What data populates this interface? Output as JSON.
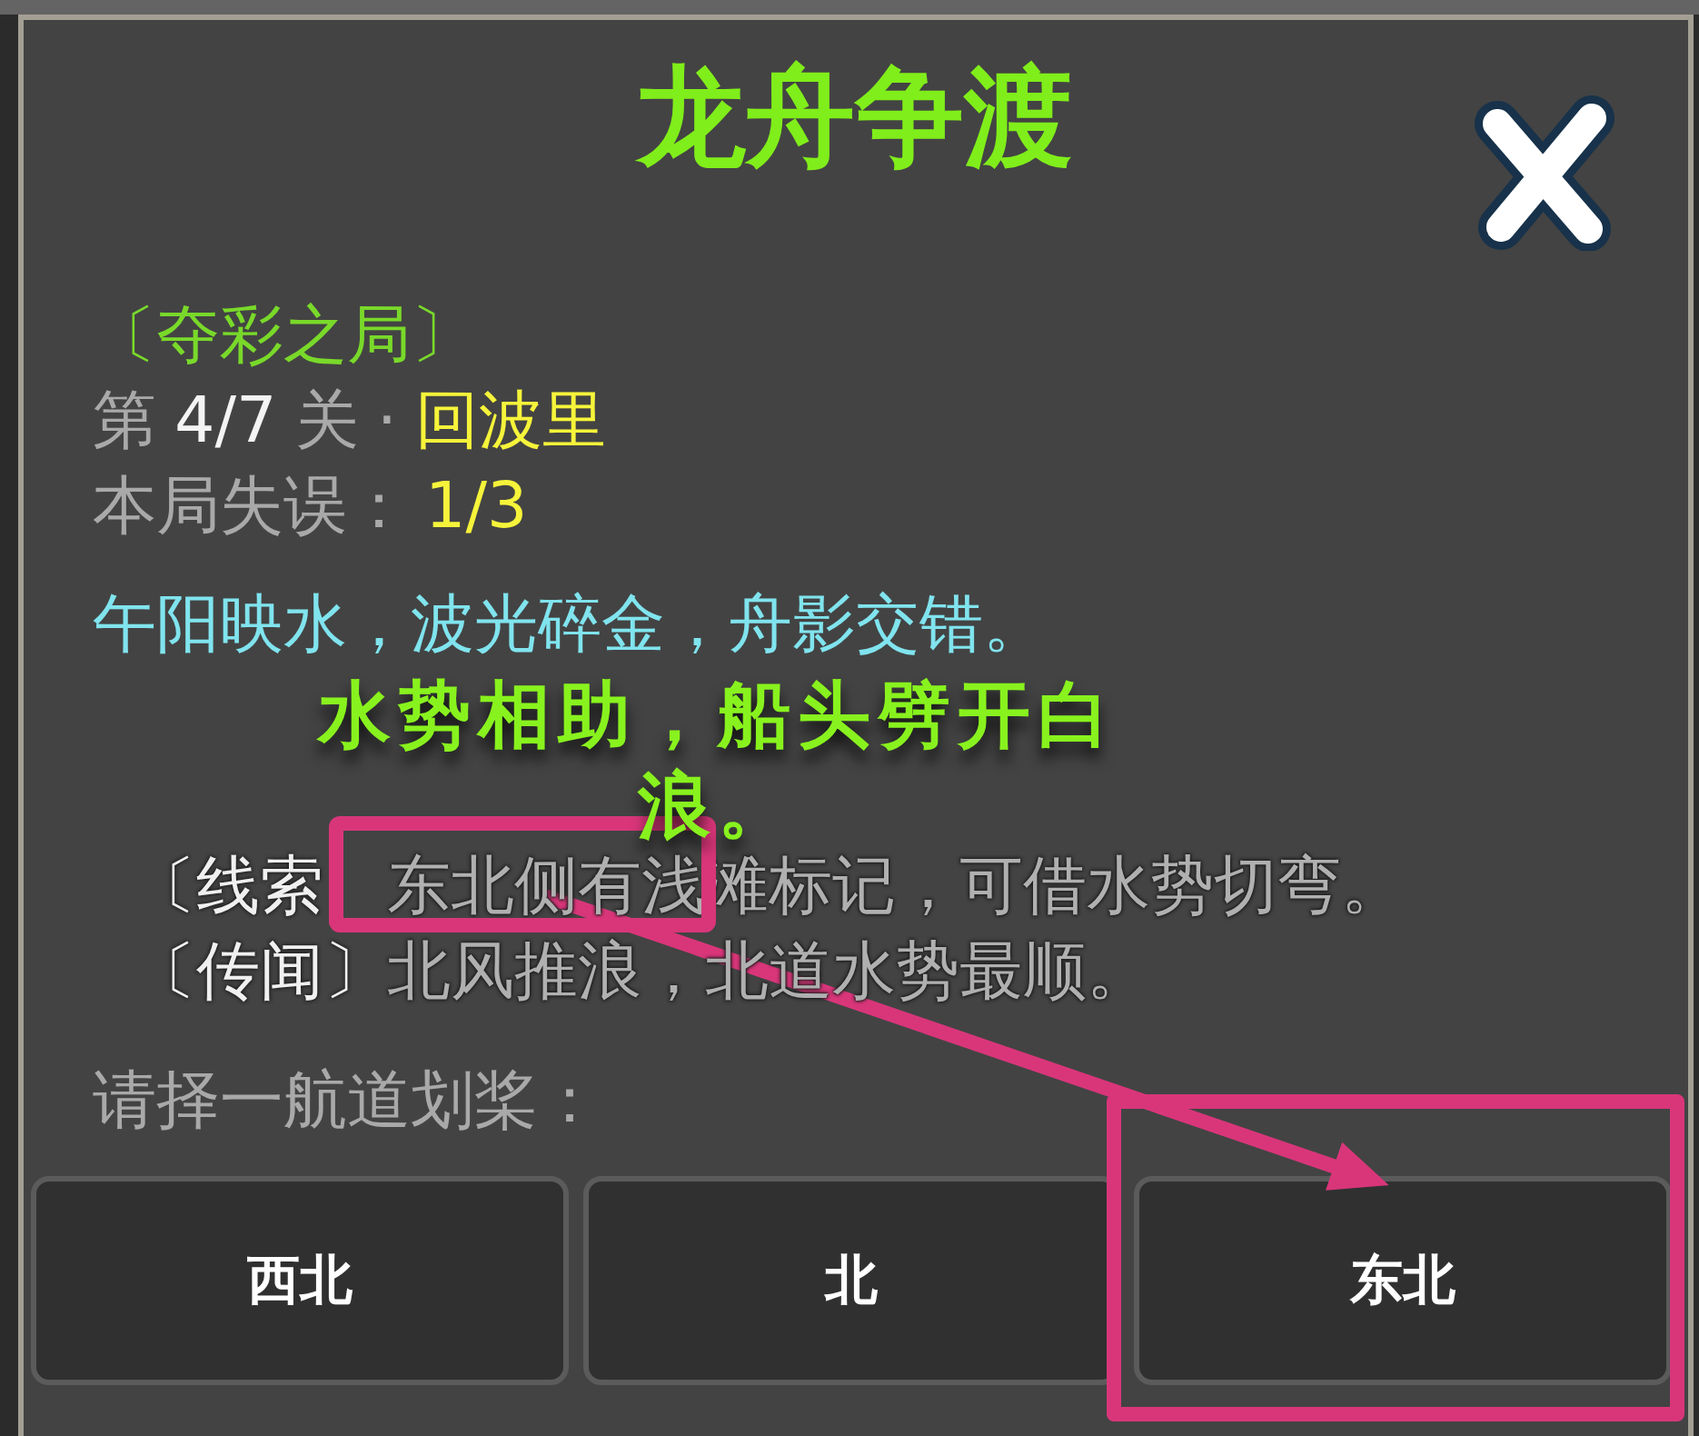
{
  "dialog": {
    "title": "龙舟争渡"
  },
  "round_title": "〔夺彩之局〕",
  "stage": {
    "prefix": "第",
    "current": "4/7",
    "suffix": "关",
    "separator": "·",
    "name": "回波里"
  },
  "mistakes": {
    "label": "本局失误：",
    "value": "1/3"
  },
  "scene": "午阳映水，波光碎金，舟影交错。",
  "hints": [
    {
      "label": "〔线索",
      "text": "东北侧有浅滩标记，可借水势切弯。",
      "highlighted": true
    },
    {
      "label": "〔传闻〕",
      "text": "北风推浪，北道水势最顺。",
      "highlighted": false
    }
  ],
  "prompt": "请择一航道划桨：",
  "choices": [
    {
      "label": "西北",
      "highlighted": false
    },
    {
      "label": "北",
      "highlighted": false
    },
    {
      "label": "东北",
      "highlighted": true
    }
  ],
  "toast": "水势相助，船头劈开白浪。"
}
